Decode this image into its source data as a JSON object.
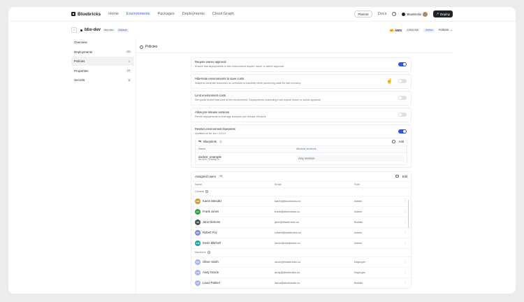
{
  "topnav": {
    "brand": "Bluebricks",
    "links": [
      "Home",
      "Environments",
      "Packages",
      "Deployments",
      "Cloud Graph"
    ],
    "active_link": "Environments",
    "planner": "Planner",
    "docs": "Docs",
    "org": "Bluebricks",
    "deploy": "Deploy"
  },
  "env": {
    "name": "bbx-dev",
    "slug": "bbx-dev",
    "default_badge": "Default",
    "cloud": "AWS",
    "account": "12661056",
    "status": "Active",
    "actions": "Actions"
  },
  "sidebar": {
    "items": [
      {
        "label": "Overview",
        "count": ""
      },
      {
        "label": "Deployments",
        "count": "03"
      },
      {
        "label": "Policies",
        "count": "1"
      },
      {
        "label": "Properties",
        "count": "19"
      },
      {
        "label": "Secrets",
        "count": "8"
      }
    ],
    "active": "Policies"
  },
  "section": {
    "title": "Policies"
  },
  "policies": [
    {
      "title": "Require owner approval",
      "desc": "Ensure that deployments to this environment require owner or admin approval",
      "on": true
    },
    {
      "title": "Hibernate environments to save costs",
      "desc": "Suspend compute resources on schedule or inactivity while preserving state for fast recovery",
      "on": false
    },
    {
      "title": "Limit environment costs",
      "desc": "Set quota for the total cost of this environment. Deployments exceeding it will require owner or admin approval",
      "on": false
    },
    {
      "title": "Allow pre-release versions",
      "desc": "Permit deployments to leverage blueprint pre-release versions",
      "on": false
    }
  ],
  "blueprints": {
    "title": "Restrict environment blueprints",
    "updated": "Updated on 5e Jun • 19:19",
    "on": true,
    "panel_title": "Blueprints",
    "count": "1",
    "add": "Add",
    "col_name": "Name",
    "col_versions": "Allowed versions",
    "rows": [
      {
        "name": "docker_example",
        "slug": "docker-example",
        "version": "Any version"
      }
    ]
  },
  "users": {
    "title": "Assigned users",
    "count": "19",
    "edit": "Edit",
    "col_name": "Name",
    "col_email": "Email",
    "col_role": "Role",
    "groups": [
      {
        "label": "Owners",
        "rows": [
          {
            "initials": "KM",
            "name": "Karen Mendez",
            "email": "karen@bluebricks.co",
            "role": "Admin",
            "color": "#c99a3a"
          },
          {
            "initials": "FJ",
            "name": "Frank Jones",
            "email": "frank@bluebricks.co",
            "role": "Admin",
            "color": "#2f9e44"
          },
          {
            "initials": "JD",
            "name": "Jane Dickens",
            "email": "jane@bluebricks.co",
            "role": "Builder",
            "color": "#495057"
          },
          {
            "initials": "RF",
            "name": "Robert Fox",
            "email": "robert@bluebricks.co",
            "role": "Admin",
            "color": "#7b8cd6"
          },
          {
            "initials": "KM",
            "name": "Kevin Mitchell",
            "email": "kevin@bluebricks.co",
            "role": "Admin",
            "color": "#20a4a0"
          }
        ]
      },
      {
        "label": "Members",
        "rows": [
          {
            "initials": "OS",
            "name": "Oliver Smith",
            "email": "oliver@bluebricks.co",
            "role": "Deployer",
            "color": "#aab4e8"
          },
          {
            "initials": "AG",
            "name": "Andy Gracie",
            "email": "andy@bluebricks.co",
            "role": "Deployer",
            "color": "#aab4e8"
          },
          {
            "initials": "LP",
            "name": "Laura Palmer",
            "email": "laura@bluebricks.co",
            "role": "Builder",
            "color": "#aab4e8"
          }
        ]
      }
    ]
  }
}
